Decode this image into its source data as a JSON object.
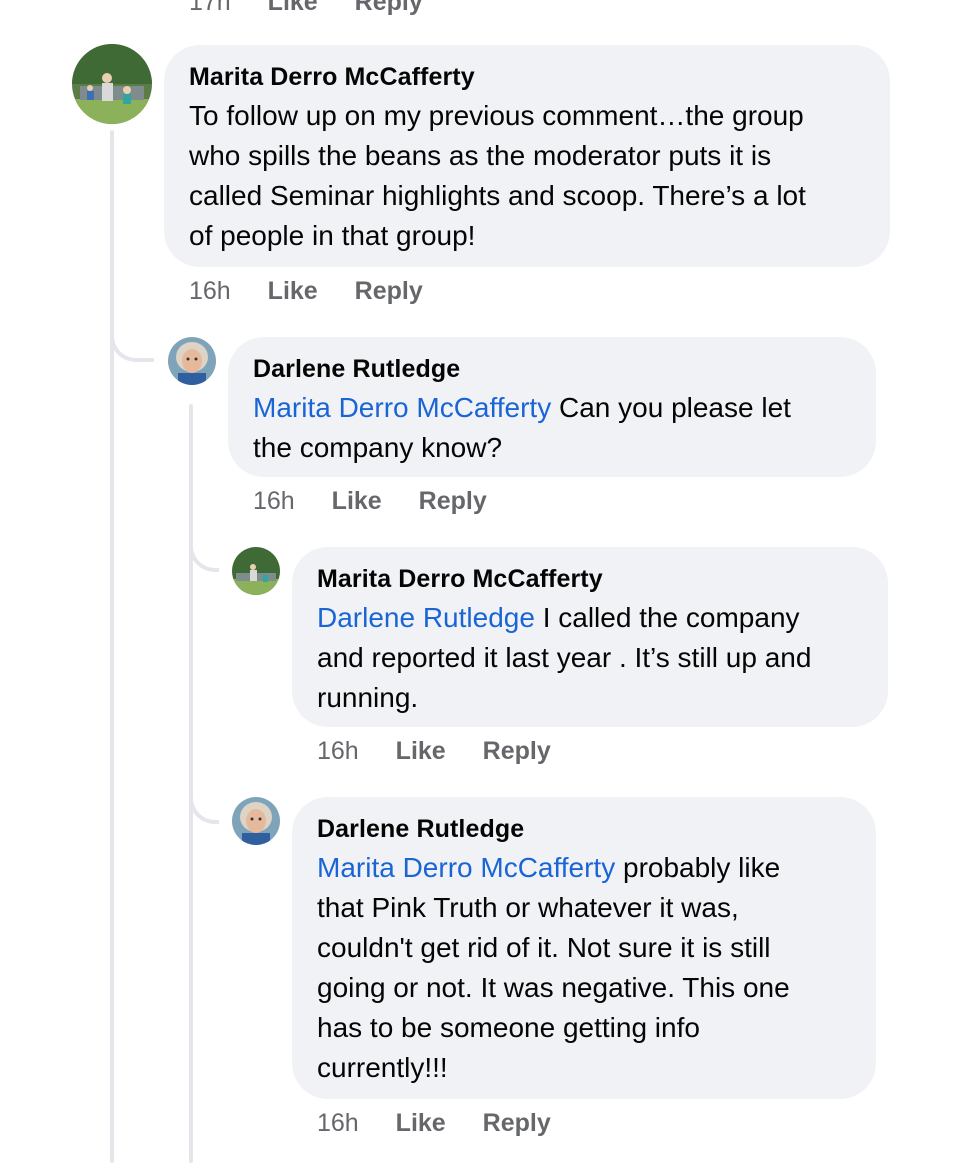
{
  "top_partial": {
    "time": "17h",
    "like": "Like",
    "reply": "Reply"
  },
  "comments": [
    {
      "author": "Marita Derro McCafferty",
      "mention": "",
      "text": "To follow up on my previous comment…the group\nwho spills the beans as the moderator puts it is\ncalled Seminar highlights and scoop. There’s a lot\nof people in that group!",
      "time": "16h",
      "like": "Like",
      "reply": "Reply"
    },
    {
      "author": "Darlene Rutledge",
      "mention": "Marita Derro McCafferty",
      "text": "  Can you please let\nthe company know?",
      "time": "16h",
      "like": "Like",
      "reply": "Reply"
    },
    {
      "author": "Marita Derro McCafferty",
      "mention": "Darlene Rutledge",
      "text": " I called the company\nand reported it last year . It’s still up and\nrunning.",
      "time": "16h",
      "like": "Like",
      "reply": "Reply"
    },
    {
      "author": "Darlene Rutledge",
      "mention": "Marita Derro McCafferty",
      "text": " probably like\nthat Pink Truth or whatever it was,\ncouldn't get rid of it.  Not sure it is still\ngoing or not.  It was negative.  This one\nhas to be someone getting info\ncurrently!!!",
      "time": "16h",
      "like": "Like",
      "reply": "Reply"
    }
  ]
}
